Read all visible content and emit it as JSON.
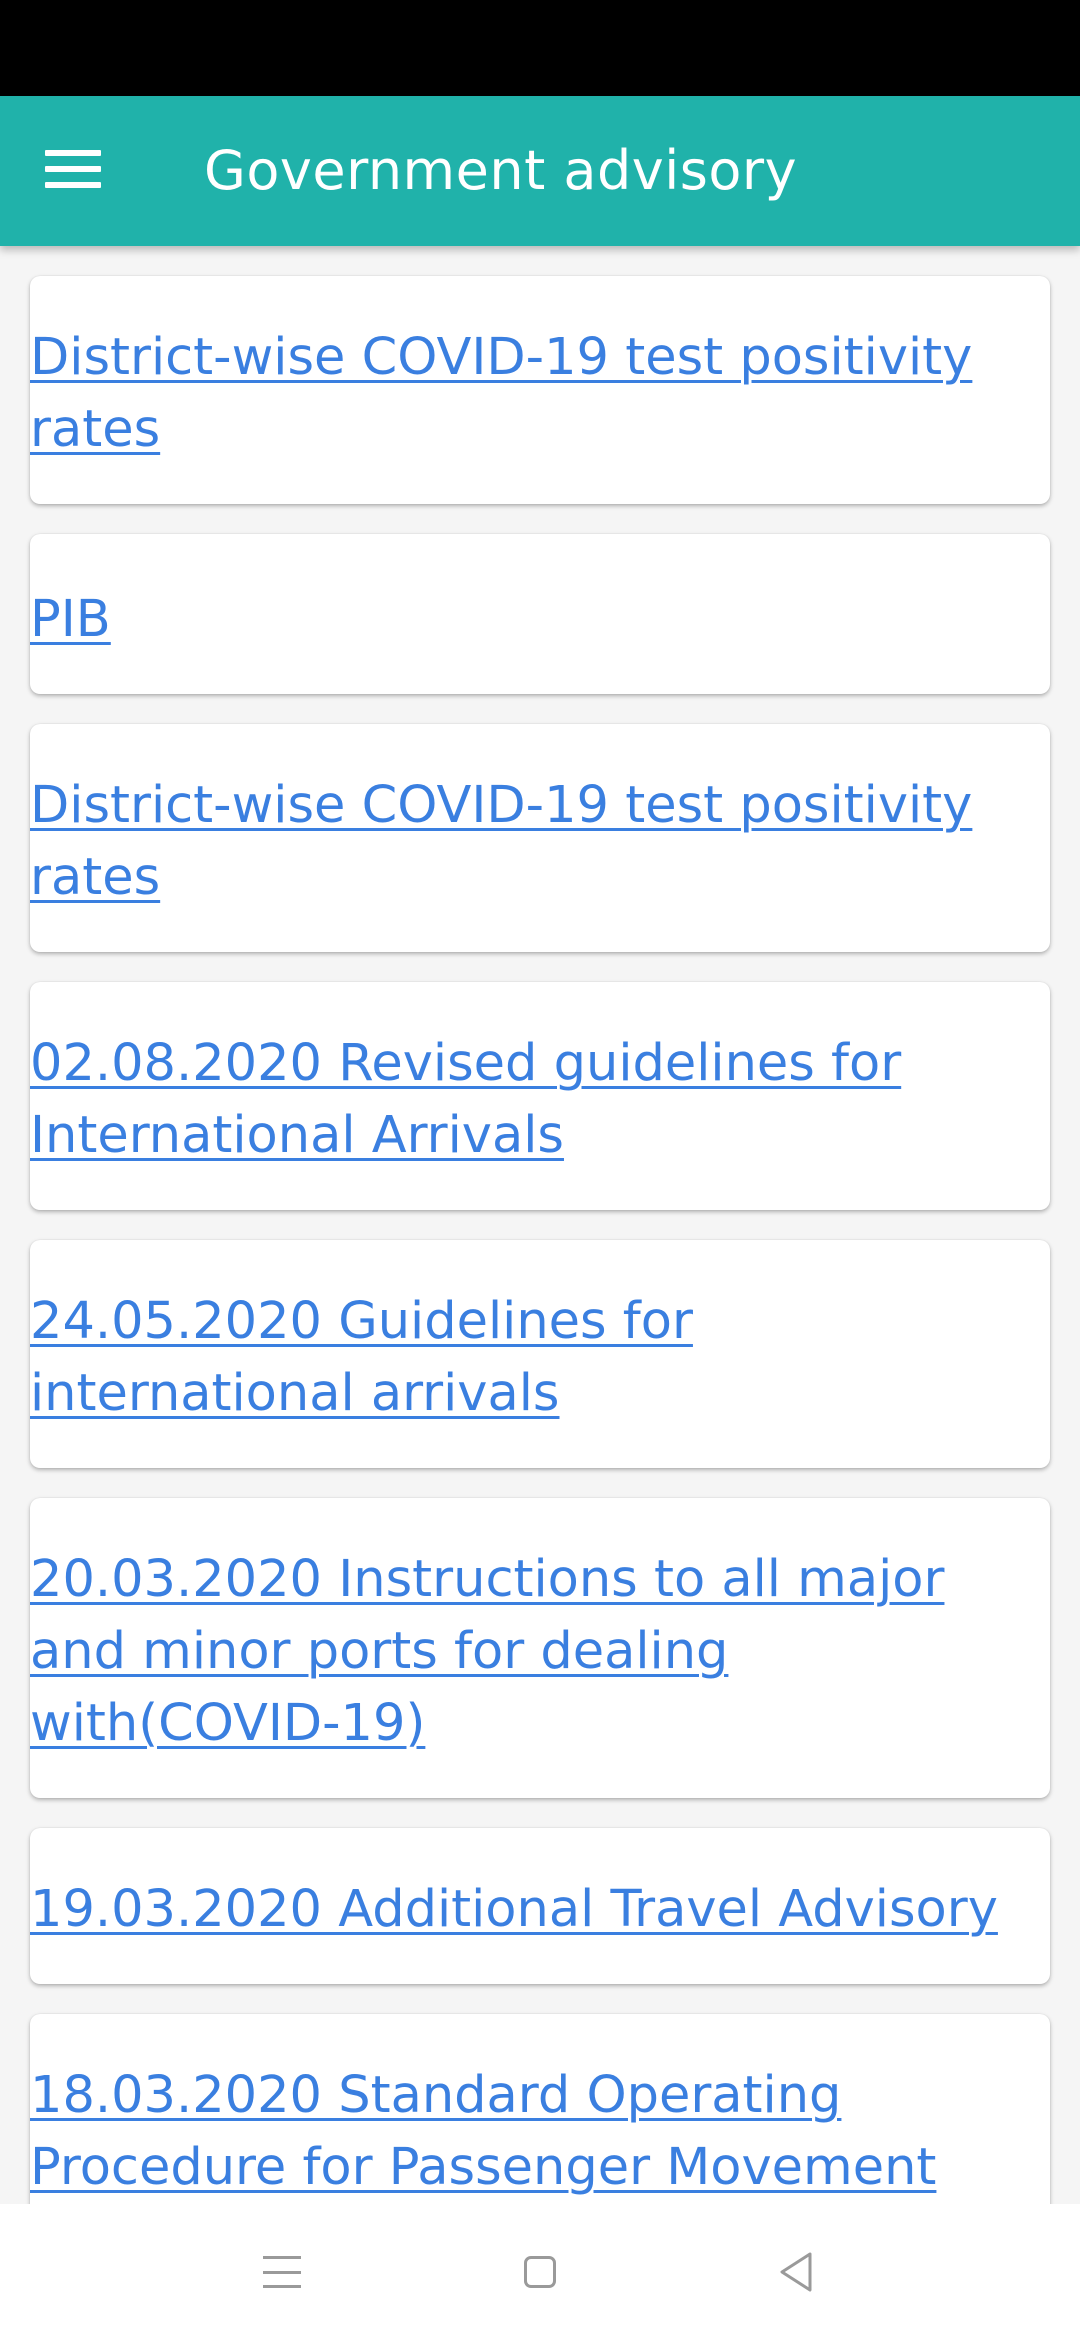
{
  "app_bar": {
    "title": "Government advisory",
    "background": "#20b2aa",
    "menu_icon": "hamburger-menu-icon"
  },
  "advisories": [
    {
      "label": "District-wise COVID-19 test positivity rates"
    },
    {
      "label": "PIB"
    },
    {
      "label": "District-wise COVID-19 test positivity rates"
    },
    {
      "label": "02.08.2020 Revised guidelines for International Arrivals"
    },
    {
      "label": "24.05.2020 Guidelines for international arrivals"
    },
    {
      "label": "20.03.2020 Instructions to all major and minor ports for dealing with(COVID-19)"
    },
    {
      "label": "19.03.2020 Additional Travel Advisory"
    },
    {
      "label": "18.03.2020 Standard Operating Procedure for Passenger Movement"
    }
  ],
  "link_color": "#3a7fe0",
  "nav_bar": {
    "icons": [
      "recent-apps-icon",
      "home-icon",
      "back-icon"
    ]
  }
}
